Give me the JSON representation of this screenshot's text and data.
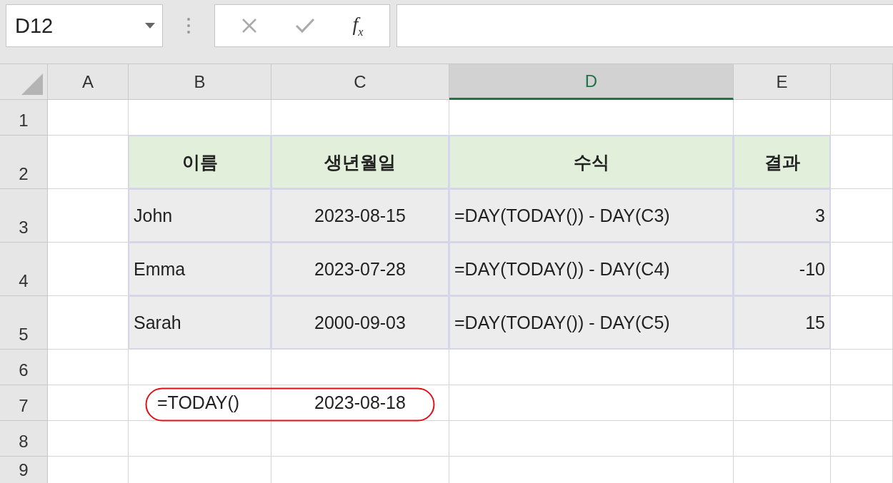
{
  "name_box": {
    "value": "D12"
  },
  "formula_bar": {
    "function_label": "f$_{x}$"
  },
  "columns": [
    {
      "label": "A",
      "selected": false
    },
    {
      "label": "B",
      "selected": false
    },
    {
      "label": "C",
      "selected": false
    },
    {
      "label": "D",
      "selected": true
    },
    {
      "label": "E",
      "selected": false
    }
  ],
  "rows": [
    "1",
    "2",
    "3",
    "4",
    "5",
    "6",
    "7",
    "8",
    "9"
  ],
  "table": {
    "headers": [
      "이름",
      "생년월일",
      "수식",
      "결과"
    ],
    "rows": [
      [
        "John",
        "2023-08-15",
        "=DAY(TODAY()) - DAY(C3)",
        "3"
      ],
      [
        "Emma",
        "2023-07-28",
        "=DAY(TODAY()) - DAY(C4)",
        "-10"
      ],
      [
        "Sarah",
        "2000-09-03",
        "=DAY(TODAY()) - DAY(C5)",
        "15"
      ]
    ]
  },
  "annotation": {
    "formula": "=TODAY()",
    "value": "2023-08-18"
  }
}
